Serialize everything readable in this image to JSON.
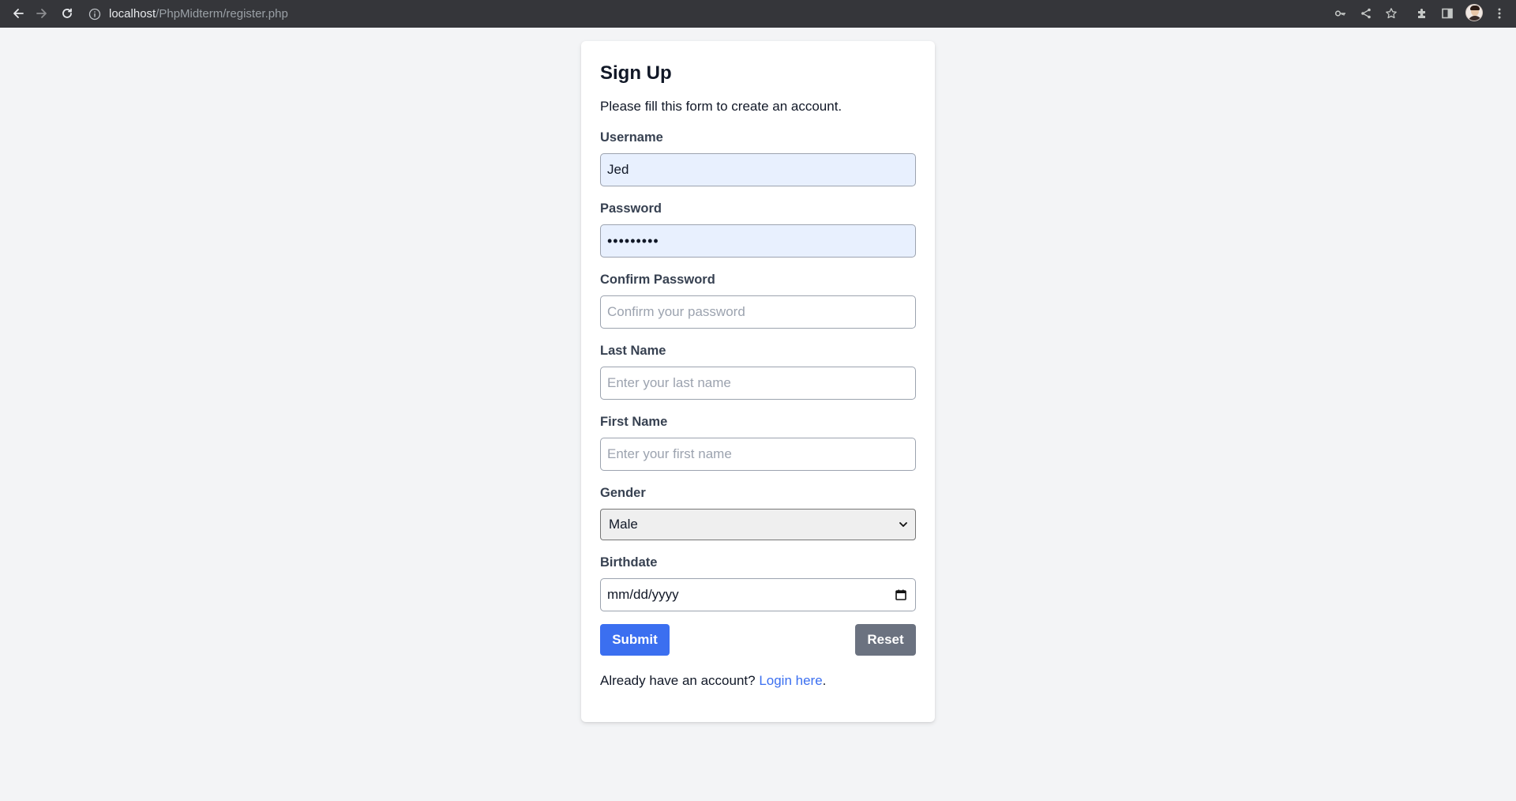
{
  "browser": {
    "url_host": "localhost",
    "url_path": "/PhpMidterm/register.php"
  },
  "form": {
    "title": "Sign Up",
    "subtitle": "Please fill this form to create an account.",
    "username": {
      "label": "Username",
      "value": "Jed"
    },
    "password": {
      "label": "Password",
      "value": "•••••••••"
    },
    "confirm_password": {
      "label": "Confirm Password",
      "placeholder": "Confirm your password"
    },
    "last_name": {
      "label": "Last Name",
      "placeholder": "Enter your last name"
    },
    "first_name": {
      "label": "First Name",
      "placeholder": "Enter your first name"
    },
    "gender": {
      "label": "Gender",
      "selected": "Male"
    },
    "birthdate": {
      "label": "Birthdate",
      "placeholder": "mm/dd/yyyy"
    },
    "submit_label": "Submit",
    "reset_label": "Reset",
    "footer_prefix": "Already have an account? ",
    "login_link": "Login here",
    "footer_suffix": "."
  },
  "colors": {
    "primary": "#3b6ff0",
    "secondary": "#6b7280",
    "autofill": "#e8f0fe",
    "page_bg": "#f3f4f6"
  }
}
